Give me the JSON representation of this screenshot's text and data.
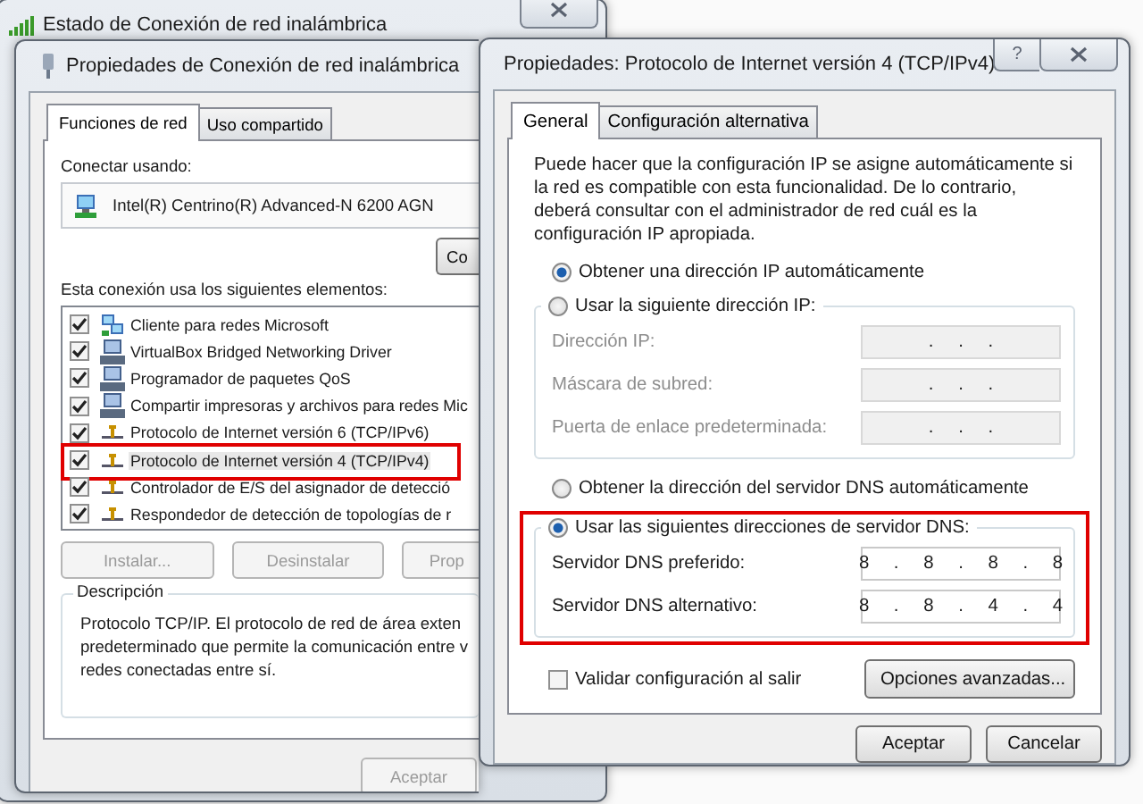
{
  "status_window": {
    "title": "Estado de Conexión de red inalámbrica"
  },
  "properties_window": {
    "title": "Propiedades de Conexión de red inalámbrica",
    "tabs": [
      {
        "label": "Funciones de red",
        "selected": true
      },
      {
        "label": "Uso compartido",
        "selected": false
      }
    ],
    "connect_label": "Conectar usando:",
    "adapter": "Intel(R) Centrino(R) Advanced-N 6200 AGN",
    "configure_button": "Co",
    "items_label": "Esta conexión usa los siguientes elementos:",
    "items": [
      {
        "kind": "client",
        "label": "Cliente para redes Microsoft",
        "checked": true,
        "selected": false,
        "highlighted": false
      },
      {
        "kind": "service",
        "label": "VirtualBox Bridged Networking Driver",
        "checked": true,
        "selected": false,
        "highlighted": false
      },
      {
        "kind": "service",
        "label": "Programador de paquetes QoS",
        "checked": true,
        "selected": false,
        "highlighted": false
      },
      {
        "kind": "service",
        "label": "Compartir impresoras y archivos para redes Mic",
        "checked": true,
        "selected": false,
        "highlighted": false
      },
      {
        "kind": "protocol",
        "label": "Protocolo de Internet versión 6 (TCP/IPv6)",
        "checked": true,
        "selected": false,
        "highlighted": false
      },
      {
        "kind": "protocol",
        "label": "Protocolo de Internet versión 4 (TCP/IPv4)",
        "checked": true,
        "selected": true,
        "highlighted": true
      },
      {
        "kind": "protocol",
        "label": "Controlador de E/S del asignador de detecció",
        "checked": true,
        "selected": false,
        "highlighted": false
      },
      {
        "kind": "protocol",
        "label": "Respondedor de detección de topologías de r",
        "checked": true,
        "selected": false,
        "highlighted": false
      }
    ],
    "buttons": [
      {
        "label": "Instalar...",
        "disabled": true
      },
      {
        "label": "Desinstalar",
        "disabled": true
      },
      {
        "label": "Prop",
        "disabled": true
      }
    ],
    "description": {
      "legend": "Descripción",
      "text": "Protocolo TCP/IP. El protocolo de red de área exten\npredeterminado que permite la comunicación entre v\nredes conectadas entre sí."
    },
    "ok_button": {
      "label": "Aceptar",
      "disabled": true
    }
  },
  "ipv4_dialog": {
    "title": "Propiedades: Protocolo de Internet versión 4 (TCP/IPv4)",
    "help_button": "?",
    "tabs": [
      {
        "label": "General",
        "selected": true
      },
      {
        "label": "Configuración alternativa",
        "selected": false
      }
    ],
    "intro": "Puede hacer que la configuración IP se asigne automáticamente si la red es compatible con esta funcionalidad. De lo contrario, deberá consultar con el administrador de red cuál es la configuración IP apropiada.",
    "ip_options": [
      {
        "label": "Obtener una dirección IP automáticamente",
        "selected": true
      },
      {
        "label": "Usar la siguiente dirección IP:",
        "selected": false
      }
    ],
    "ip_fields": [
      {
        "label": "Dirección IP:",
        "value": ". . .",
        "disabled": true
      },
      {
        "label": "Máscara de subred:",
        "value": ". . .",
        "disabled": true
      },
      {
        "label": "Puerta de enlace predeterminada:",
        "value": ". . .",
        "disabled": true
      }
    ],
    "dns_options": [
      {
        "label": "Obtener la dirección del servidor DNS automáticamente",
        "selected": false
      },
      {
        "label": "Usar las siguientes direcciones de servidor DNS:",
        "selected": true
      }
    ],
    "dns_highlighted": true,
    "dns_fields": [
      {
        "label": "Servidor DNS preferido:",
        "value": "8 . 8 . 8 . 8",
        "disabled": false
      },
      {
        "label": "Servidor DNS alternativo:",
        "value": "8 . 8 . 4 . 4",
        "disabled": false
      }
    ],
    "validate": {
      "label": "Validar configuración al salir",
      "checked": false
    },
    "advanced_button": "Opciones avanzadas...",
    "buttons": [
      {
        "label": "Aceptar"
      },
      {
        "label": "Cancelar"
      }
    ]
  }
}
